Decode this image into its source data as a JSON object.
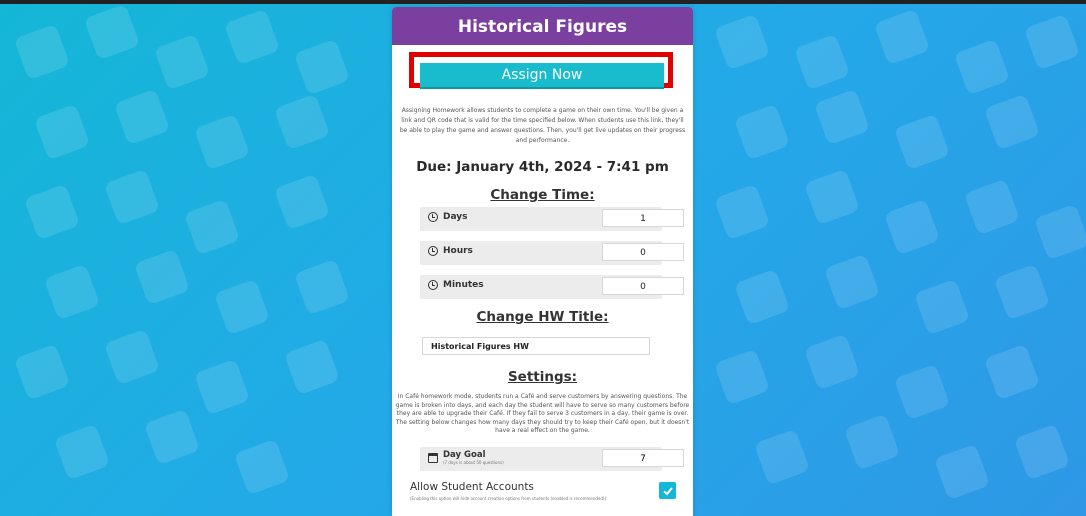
{
  "panel": {
    "title": "Historical Figures",
    "assign_label": "Assign Now",
    "description": "Assigning Homework allows students to complete a game on their own time. You'll be given a link and QR code that is valid for the time specified below. When students use this link, they'll be able to play the game and answer questions. Then, you'll get live updates on their progress and performance.",
    "due": "Due: January 4th, 2024 - 7:41 pm"
  },
  "change_time": {
    "title": "Change Time:",
    "rows": [
      {
        "label": "Days",
        "value": "1"
      },
      {
        "label": "Hours",
        "value": "0"
      },
      {
        "label": "Minutes",
        "value": "0"
      }
    ]
  },
  "hw_title": {
    "title": "Change HW Title:",
    "value": "Historical Figures HW"
  },
  "settings": {
    "title": "Settings:",
    "description": "In Café homework mode, students run a Café and serve customers by answering questions. The game is broken into days, and each day the student will have to serve so many customers before they are able to upgrade their Café. If they fail to serve 3 customers in a day, their game is over. The setting below changes how many days they should try to keep their Café open, but it doesn't have a real effect on the game.",
    "day_goal_label": "Day Goal",
    "day_goal_sub": "(7 days is about 50 questions)",
    "day_goal_value": "7",
    "accounts_label": "Allow Student Accounts",
    "accounts_sub": "(Enabling this option will hide account creation options from students (enabled is recommended))",
    "accounts_checked": true
  },
  "colors": {
    "header": "#7b3fa0",
    "accent": "#18bccc",
    "highlight": "#e00000"
  }
}
